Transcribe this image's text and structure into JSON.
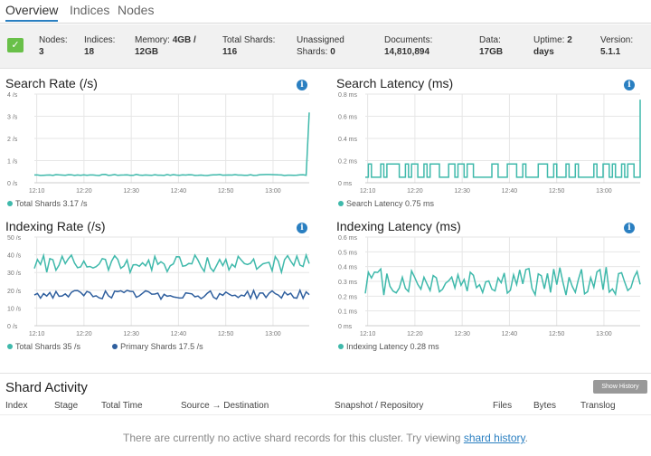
{
  "tabs": [
    {
      "label": "Overview",
      "active": true
    },
    {
      "label": "Indices",
      "active": false
    },
    {
      "label": "Nodes",
      "active": false
    }
  ],
  "status": {
    "health_color": "#69c049",
    "stats": [
      {
        "label": "Nodes:",
        "value": "3"
      },
      {
        "label": "Indices:",
        "value": "18"
      },
      {
        "label": "Memory:",
        "value": "4GB / 12GB"
      },
      {
        "label": "Total Shards:",
        "value": "116"
      },
      {
        "label": "Unassigned Shards:",
        "value": "0"
      },
      {
        "label": "Documents:",
        "value": "14,810,894"
      },
      {
        "label": "Data:",
        "value": "17GB"
      },
      {
        "label": "Uptime:",
        "value": "2 days"
      },
      {
        "label": "Version:",
        "value": "5.1.1"
      }
    ]
  },
  "chart_data": [
    {
      "type": "line",
      "title": "Search Rate (/s)",
      "x_ticks": [
        "12:10",
        "12:20",
        "12:30",
        "12:40",
        "12:50",
        "13:00"
      ],
      "y_ticks": [
        "0 /s",
        "1 /s",
        "2 /s",
        "3 /s",
        "4 /s"
      ],
      "ylim": [
        0,
        4
      ],
      "series": [
        {
          "name": "Total Shards",
          "legend": "Total Shards 3.17 /s",
          "color": "#3fb9ab",
          "pattern": "flat",
          "base": 0.35,
          "amp": 0.05,
          "last": 3.17
        }
      ]
    },
    {
      "type": "line",
      "title": "Search Latency (ms)",
      "x_ticks": [
        "12:10",
        "12:20",
        "12:30",
        "12:40",
        "12:50",
        "13:00"
      ],
      "y_ticks": [
        "0 ms",
        "0.2 ms",
        "0.4 ms",
        "0.6 ms",
        "0.8 ms"
      ],
      "ylim": [
        0,
        0.8
      ],
      "series": [
        {
          "name": "Search Latency",
          "legend": "Search Latency 0.75 ms",
          "color": "#3fb9ab",
          "pattern": "square",
          "base": 0.05,
          "amp": 0.12,
          "last": 0.75
        }
      ]
    },
    {
      "type": "line",
      "title": "Indexing Rate (/s)",
      "x_ticks": [
        "12:10",
        "12:20",
        "12:30",
        "12:40",
        "12:50",
        "13:00"
      ],
      "y_ticks": [
        "0 /s",
        "10 /s",
        "20 /s",
        "30 /s",
        "40 /s",
        "50 /s"
      ],
      "ylim": [
        0,
        50
      ],
      "series": [
        {
          "name": "Total Shards",
          "legend": "Total Shards 35 /s",
          "color": "#3fb9ab",
          "pattern": "noise",
          "base": 35,
          "amp": 5,
          "last": 35
        },
        {
          "name": "Primary Shards",
          "legend": "Primary Shards 17.5 /s",
          "color": "#2f5f9e",
          "pattern": "noise",
          "base": 17.5,
          "amp": 2.5,
          "last": 17.5
        }
      ]
    },
    {
      "type": "line",
      "title": "Indexing Latency (ms)",
      "x_ticks": [
        "12:10",
        "12:20",
        "12:30",
        "12:40",
        "12:50",
        "13:00"
      ],
      "y_ticks": [
        "0 ms",
        "0.1 ms",
        "0.2 ms",
        "0.3 ms",
        "0.4 ms",
        "0.5 ms",
        "0.6 ms"
      ],
      "ylim": [
        0,
        0.6
      ],
      "series": [
        {
          "name": "Indexing Latency",
          "legend": "Indexing Latency 0.28 ms",
          "color": "#3fb9ab",
          "pattern": "noise",
          "base": 0.3,
          "amp": 0.1,
          "last": 0.28
        }
      ]
    }
  ],
  "shard_activity": {
    "title": "Shard Activity",
    "show_history_label": "Show History",
    "columns": [
      "Index",
      "Stage",
      "Total Time",
      "Source → Destination",
      "Snapshot / Repository",
      "Files",
      "Bytes",
      "Translog"
    ],
    "empty_text": "There are currently no active shard records for this cluster. Try viewing ",
    "empty_link": "shard history",
    "empty_suffix": "."
  },
  "icons": {
    "info": "info-icon",
    "status": "check-icon"
  }
}
